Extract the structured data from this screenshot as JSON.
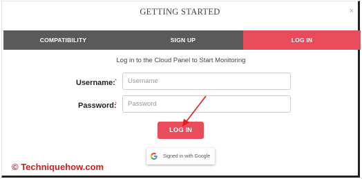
{
  "modal": {
    "title": "GETTING STARTED",
    "close_glyph": "×"
  },
  "tabs": [
    {
      "label": "COMPATIBILITY",
      "active": false
    },
    {
      "label": "SIGN UP",
      "active": false
    },
    {
      "label": "LOG IN",
      "active": true
    }
  ],
  "form": {
    "subtitle": "Log in to the Cloud Panel to Start Monitoring",
    "username": {
      "label": "Username:",
      "required_mark": "*",
      "placeholder": "Username",
      "value": ""
    },
    "password": {
      "label": "Password:",
      "required_mark": "*",
      "placeholder": "Password",
      "value": ""
    },
    "login_label": "LOG IN"
  },
  "google": {
    "label": "Signed in with Google",
    "icon": "google-g-icon"
  },
  "watermark": "© Techniquehow.com",
  "colors": {
    "accent": "#e84b5a",
    "tab_inactive": "#5a5a5a",
    "annotation_arrow": "#e11d1d",
    "watermark": "#d01c1c"
  }
}
